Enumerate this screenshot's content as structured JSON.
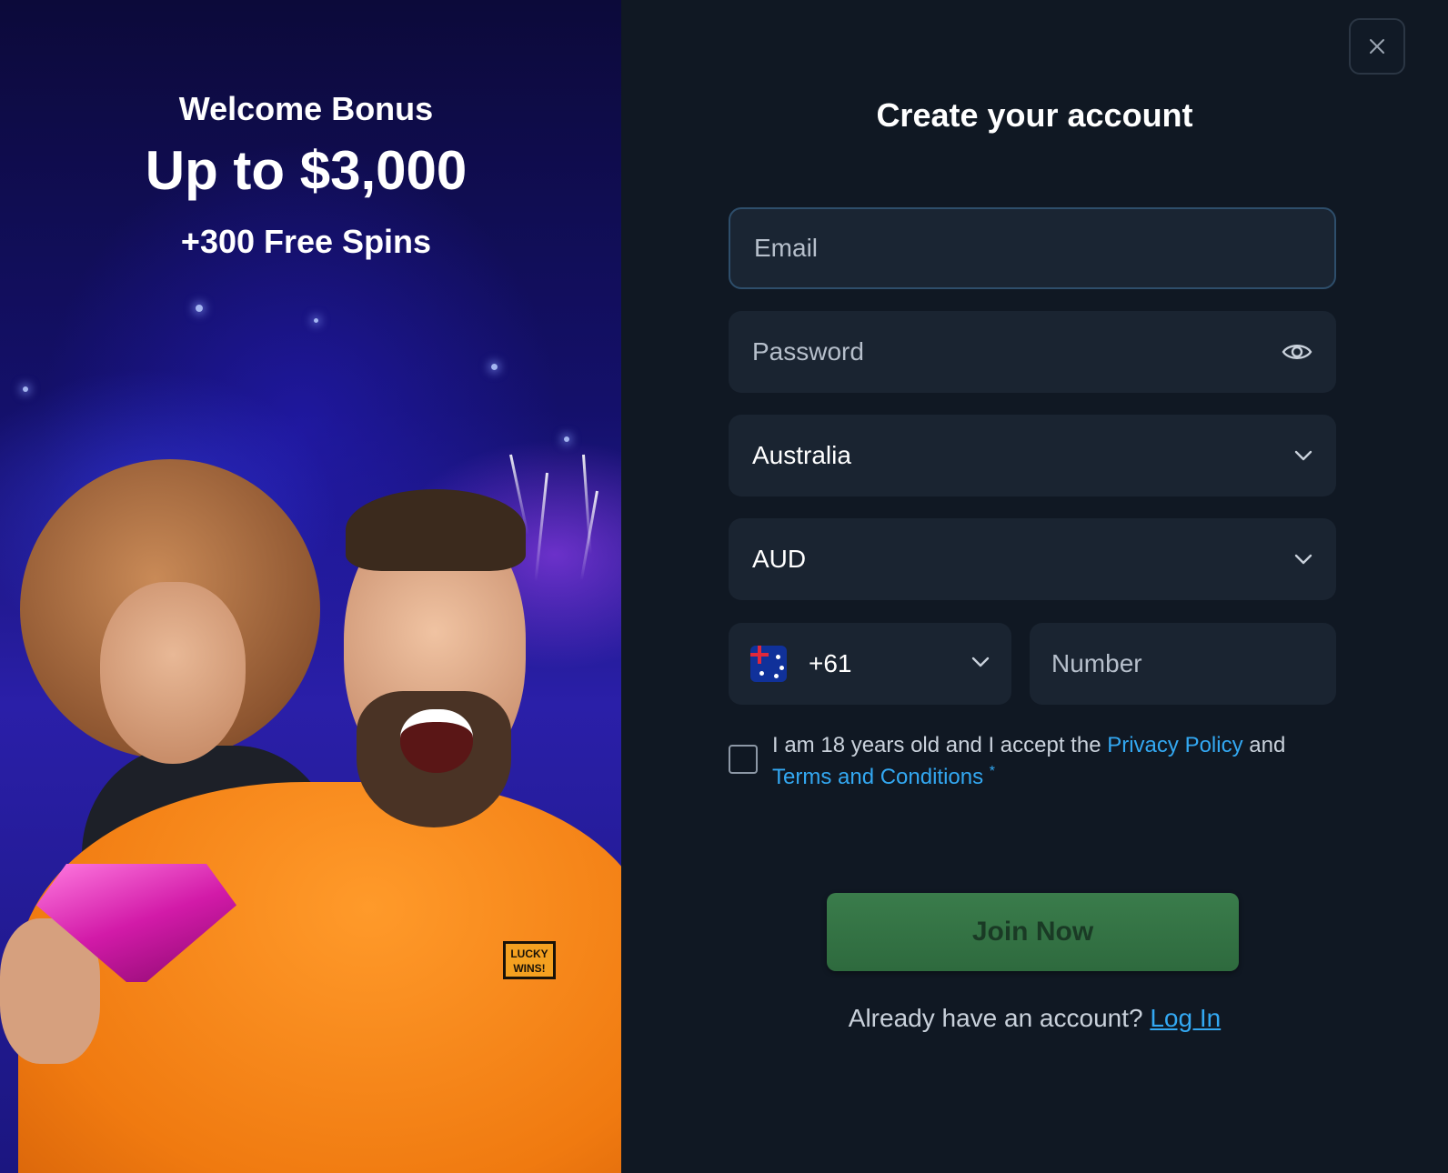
{
  "promo": {
    "eyebrow": "Welcome Bonus",
    "amount": "Up to $3,000",
    "spins": "+300 Free Spins",
    "logo_text": "LUCKY WINS!"
  },
  "form": {
    "title": "Create your account",
    "email": {
      "placeholder": "Email"
    },
    "password": {
      "placeholder": "Password",
      "toggle_icon": "eye-icon"
    },
    "country": {
      "value": "Australia",
      "icon": "chevron-down-icon"
    },
    "currency": {
      "value": "AUD",
      "icon": "chevron-down-icon"
    },
    "phone": {
      "code": "+61",
      "flag": "australia-flag-icon",
      "number_placeholder": "Number"
    },
    "consent": {
      "text_before": "I am 18 years old and I accept the ",
      "privacy_link": "Privacy Policy",
      "text_middle": " and ",
      "terms_link": "Terms and Conditions",
      "required_mark": "*"
    },
    "submit_label": "Join Now",
    "login_prompt": "Already have an account? ",
    "login_link": "Log In",
    "close_icon": "close-icon"
  },
  "colors": {
    "accent_link": "#33a8f2",
    "button": "#2e6a3e",
    "panel": "#101823",
    "field": "#1a2431"
  }
}
